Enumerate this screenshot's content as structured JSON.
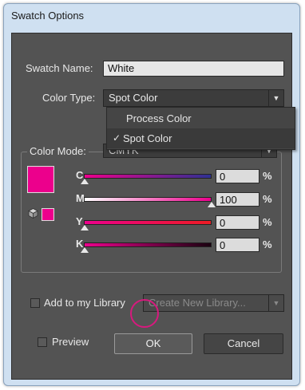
{
  "window": {
    "title": "Swatch Options"
  },
  "swatch_name": {
    "label": "Swatch Name:",
    "value": "White"
  },
  "color_type": {
    "label": "Color Type:",
    "value": "Spot Color",
    "options": [
      "Process Color",
      "Spot Color"
    ],
    "selected_index": 1
  },
  "color_mode": {
    "label": "Color Mode:",
    "value": "CMYK"
  },
  "swatch_color": "#ec008c",
  "sliders": [
    {
      "label": "C",
      "value": "0",
      "unit": "%"
    },
    {
      "label": "M",
      "value": "100",
      "unit": "%"
    },
    {
      "label": "Y",
      "value": "0",
      "unit": "%"
    },
    {
      "label": "K",
      "value": "0",
      "unit": "%"
    }
  ],
  "library": {
    "checkbox_label": "Add to my Library",
    "select_placeholder": "Create New Library..."
  },
  "preview": {
    "label": "Preview"
  },
  "buttons": {
    "ok": "OK",
    "cancel": "Cancel"
  },
  "icons": {
    "dropdown_arrow": "▼",
    "check": "✓"
  }
}
